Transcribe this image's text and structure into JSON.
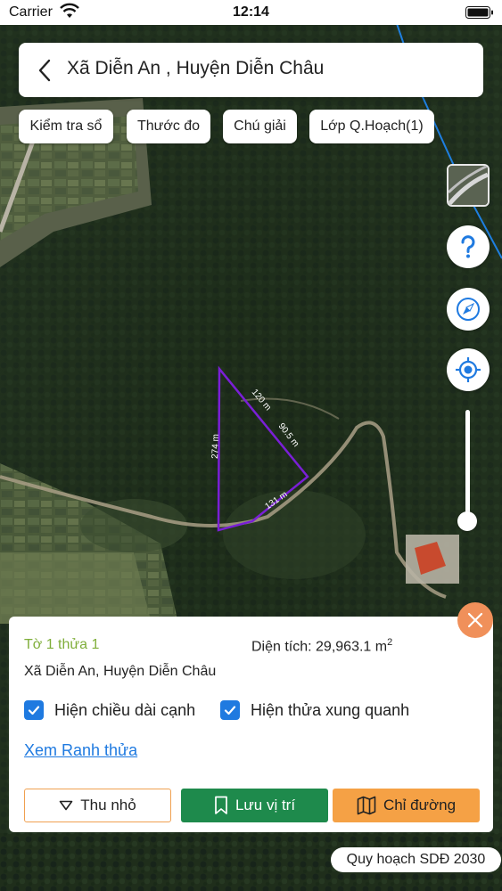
{
  "status_bar": {
    "carrier": "Carrier",
    "time": "12:14"
  },
  "header": {
    "title": "Xã Diễn An , Huyện Diễn Châu"
  },
  "toolbar": {
    "check_book": "Kiểm tra sổ",
    "ruler": "Thước đo",
    "legend": "Chú giải",
    "planning_layer": "Lớp Q.Hoạch(1)"
  },
  "map": {
    "edge_labels": [
      "120 m",
      "90.5 m",
      "131 m",
      "274 m"
    ],
    "parcel_color": "#7a1fd6",
    "boundary_color": "#1e7fe0"
  },
  "panel": {
    "parcel_id": "Tờ 1 thửa 1",
    "area_prefix": "Diện tích: 29,963.1 m",
    "area_unit_exp": "2",
    "location": "Xã Diễn An, Huyện Diễn Châu",
    "show_edge_lengths": "Hiện chiều dài cạnh",
    "show_adjacent": "Hiện thửa xung quanh",
    "view_boundary": "Xem Ranh thửa",
    "collapse": "Thu nhỏ",
    "save_location": "Lưu vị trí",
    "directions": "Chỉ đường"
  },
  "plan_badge": "Quy hoạch SDĐ 2030",
  "colors": {
    "accent_blue": "#1f7ae0",
    "save_green": "#1e8a4c",
    "directions_orange": "#f5a145",
    "close_orange": "#f0905a",
    "parcel_green_text": "#7fae3a"
  }
}
